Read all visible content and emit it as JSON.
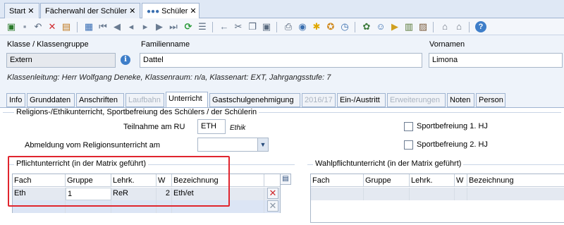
{
  "doc_tabs": [
    {
      "label": "Start",
      "close": "✕"
    },
    {
      "label": "Fächerwahl der Schüler",
      "close": "✕"
    },
    {
      "label": "Schüler",
      "close": "✕"
    }
  ],
  "header": {
    "klasse_label": "Klasse / Klassengruppe",
    "klasse_value": "Extern",
    "familienname_label": "Familienname",
    "familienname_value": "Dattel",
    "vornamen_label": "Vornamen",
    "vornamen_value": "Limona",
    "info_glyph": "i",
    "info_line": "Klassenleitung: Herr Wolfgang Deneke, Klassenraum: n/a, Klassenart: EXT, Jahrgangsstufe: 7"
  },
  "form_tabs": [
    {
      "label": "Info",
      "state": "normal"
    },
    {
      "label": "Grunddaten",
      "state": "normal"
    },
    {
      "label": "Anschriften",
      "state": "normal"
    },
    {
      "label": "Laufbahn",
      "state": "disabled"
    },
    {
      "label": "Unterricht",
      "state": "active"
    },
    {
      "label": "Gastschulgenehmigung",
      "state": "normal"
    },
    {
      "label": "2016/17",
      "state": "disabled"
    },
    {
      "label": "Ein-/Austritt",
      "state": "normal"
    },
    {
      "label": "Erweiterungen",
      "state": "disabled"
    },
    {
      "label": "Noten",
      "state": "normal"
    },
    {
      "label": "Person",
      "state": "normal"
    }
  ],
  "religion": {
    "group_title": "Religions-/Ethikunterricht, Sportbefreiung des Schülers / der Schülerin",
    "teilnahme_label": "Teilnahme am RU",
    "teilnahme_value": "ETH",
    "teilnahme_hint": "Ethik",
    "abmeldung_label": "Abmeldung vom Religionsunterricht am",
    "abmeldung_value": "",
    "sport1_label": "Sportbefreiung 1. HJ",
    "sport2_label": "Sportbefreiung 2. HJ"
  },
  "pflicht": {
    "title": "Pflichtunterricht (in der Matrix geführt)",
    "columns": [
      "Fach",
      "Gruppe",
      "Lehrk.",
      "W",
      "Bezeichnung"
    ],
    "rows": [
      {
        "fach": "Eth",
        "gruppe": "1",
        "lehrk": "ReR",
        "w": "2",
        "bezeichnung": "Eth/et"
      }
    ]
  },
  "wahl": {
    "title": "Wahlpflichtunterricht (in der Matrix geführt)",
    "columns": [
      "Fach",
      "Gruppe",
      "Lehrk.",
      "W",
      "Bezeichnung"
    ]
  },
  "colors": {
    "accent": "#3e7ec9",
    "highlight": "#e0252e",
    "selected_row": "#e4e9f1",
    "new_row": "#dce5f5"
  }
}
